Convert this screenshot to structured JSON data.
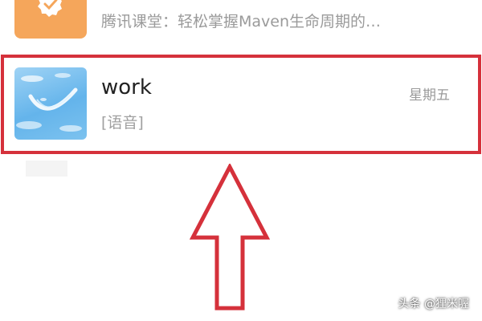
{
  "conversations": [
    {
      "preview": "腾讯课堂：轻松掌握Maven生命周期的…",
      "avatar_icon": "verified-badge-icon",
      "avatar_color": "#f5a65b"
    },
    {
      "name": "work",
      "time": "星期五",
      "preview": "[语音]",
      "avatar_icon": "sky-landscape-icon"
    }
  ],
  "annotation": {
    "highlight_color": "#d5313b",
    "arrow_icon": "up-arrow-icon"
  },
  "watermark": "头条 @狸米喔"
}
